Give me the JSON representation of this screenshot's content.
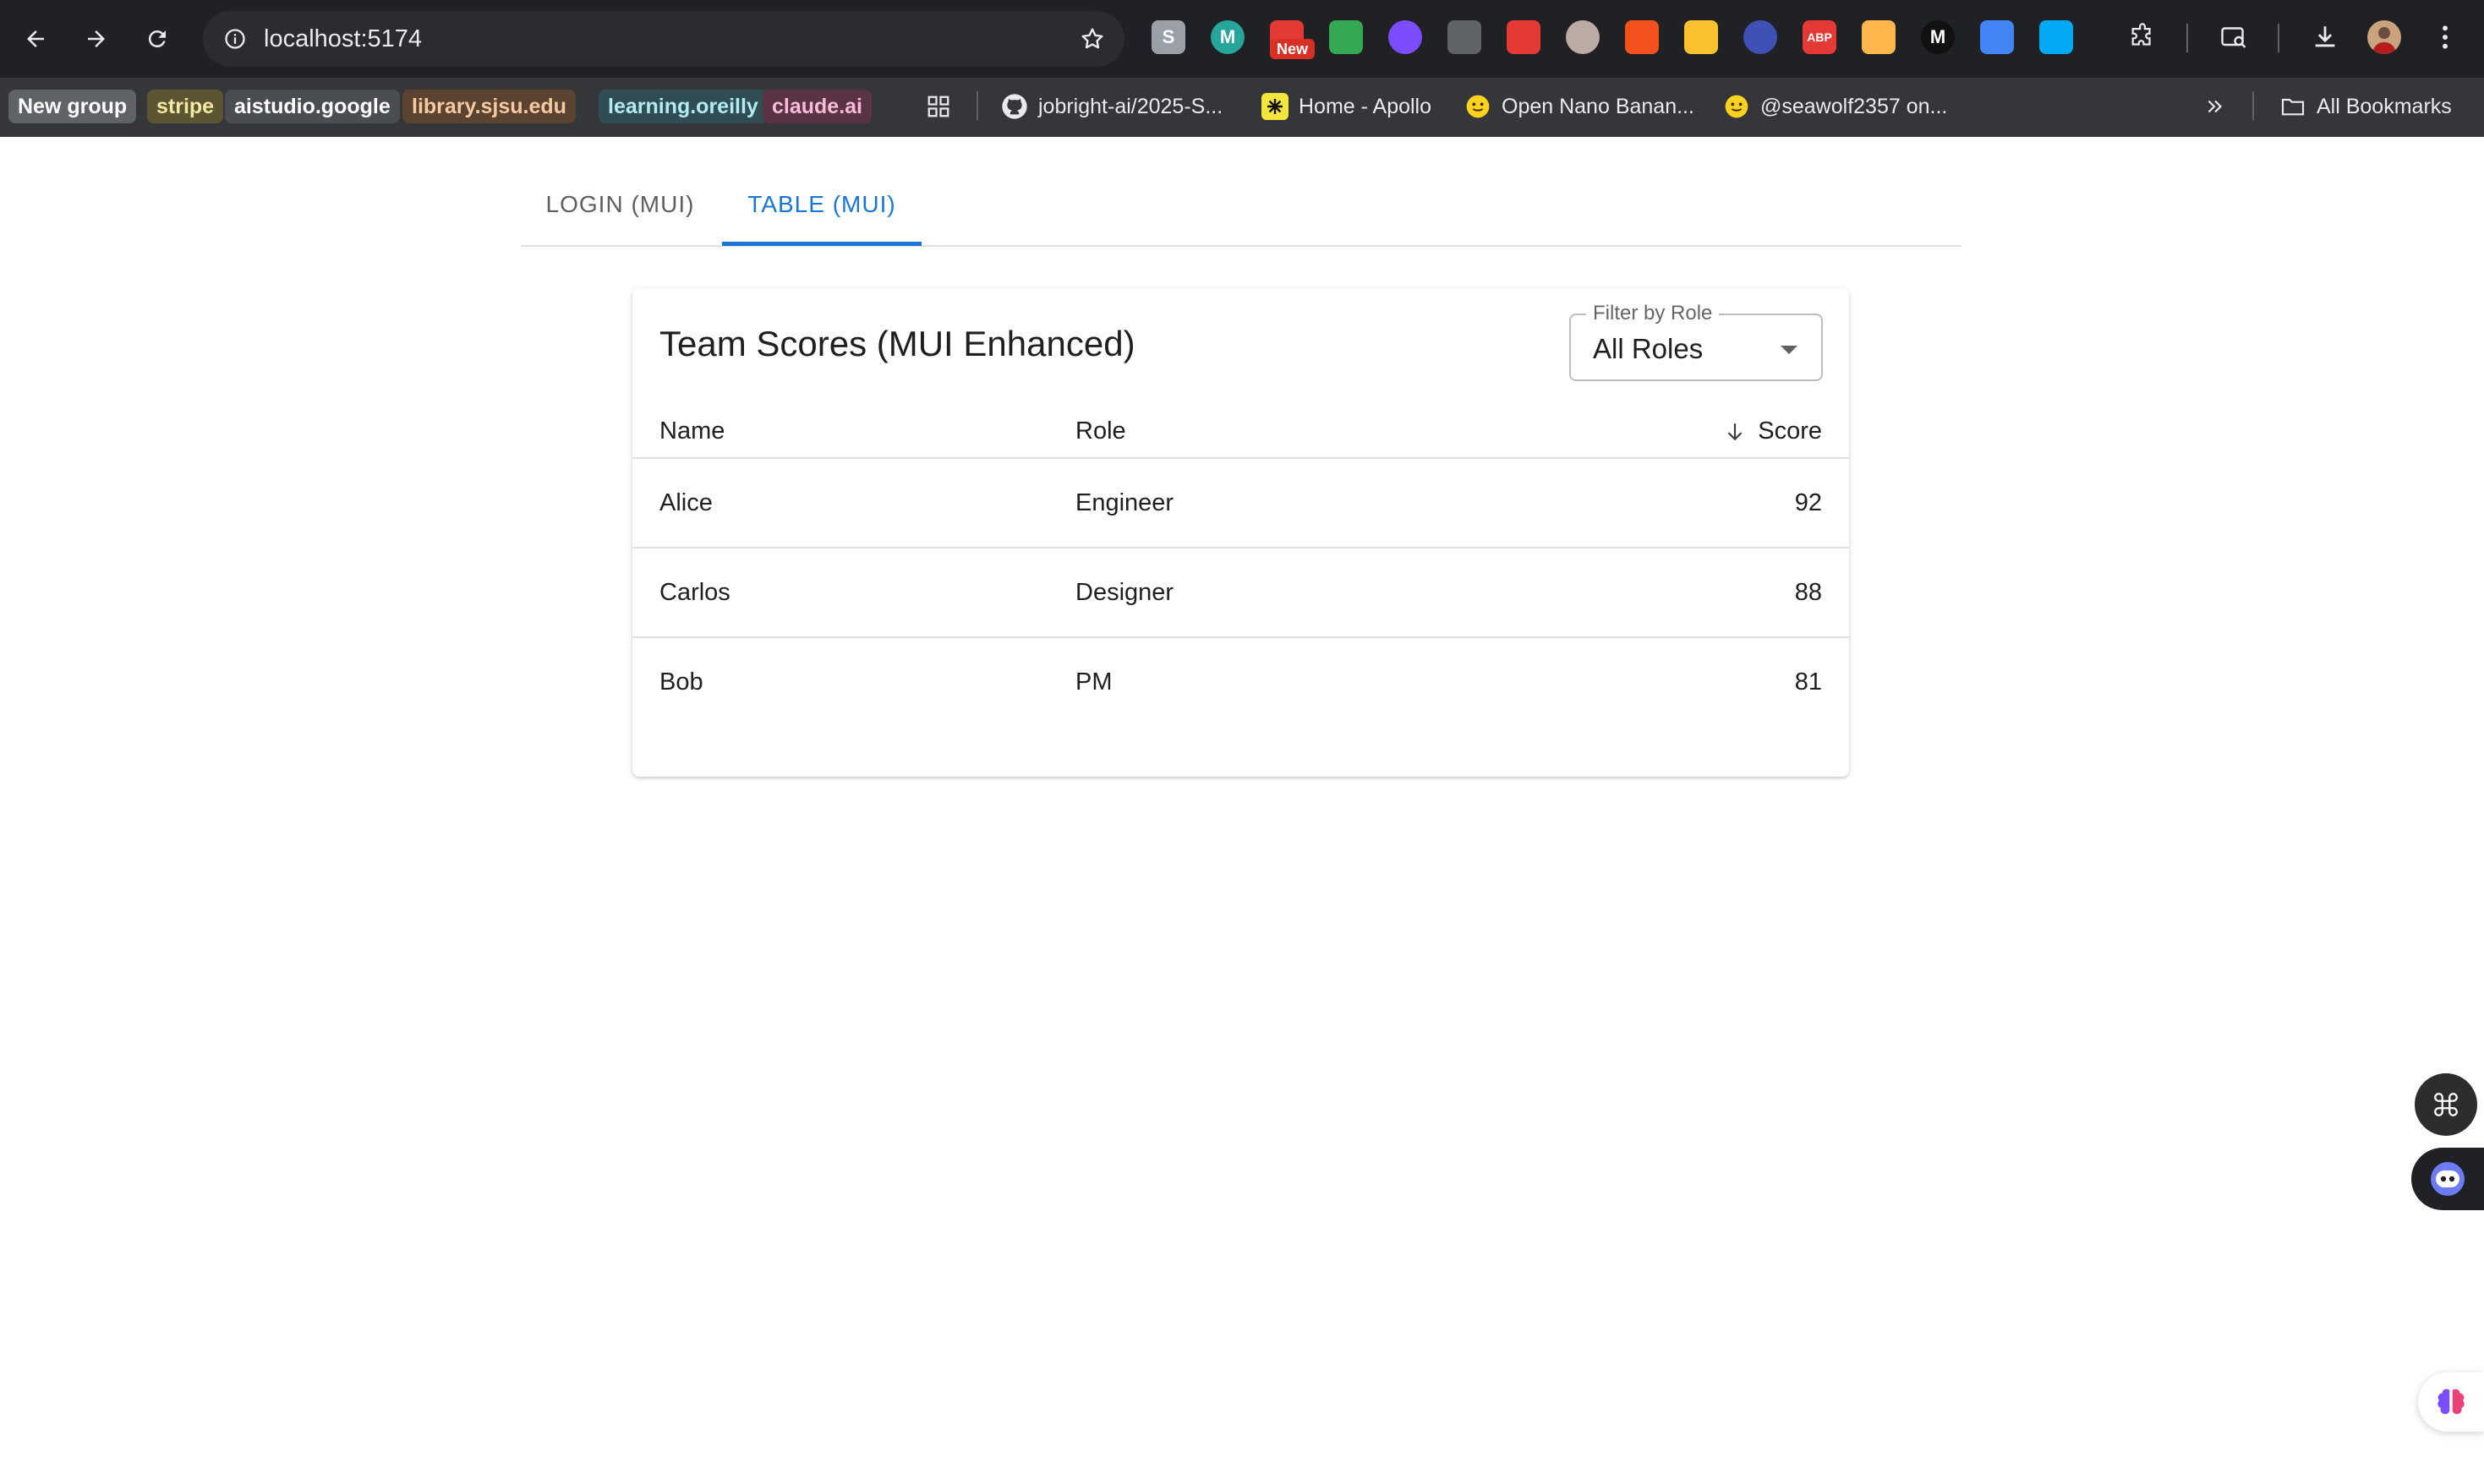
{
  "browser": {
    "url": "localhost:5174",
    "new_badge": "New",
    "extensions": [
      {
        "icon": "slack-like-extension-icon",
        "color": "#9aa0a6",
        "glyph": "S"
      },
      {
        "icon": "m-extension-icon",
        "color": "#26a69a",
        "glyph": "M"
      },
      {
        "icon": "new-extension-icon",
        "color": "#e53935",
        "glyph": ""
      },
      {
        "icon": "green-extension-icon",
        "color": "#34a853",
        "glyph": ""
      },
      {
        "icon": "brain-extension-icon",
        "color": "#7c4dff",
        "glyph": ""
      },
      {
        "icon": "reader-extension-icon",
        "color": "#5f6368",
        "glyph": ""
      },
      {
        "icon": "youtube-extension-icon",
        "color": "#e53935",
        "glyph": ""
      },
      {
        "icon": "owl-extension-icon",
        "color": "#bcaaa4",
        "glyph": ""
      },
      {
        "icon": "translate-extension-icon",
        "color": "#f4511e",
        "glyph": ""
      },
      {
        "icon": "sun-extension-icon",
        "color": "#fbc02d",
        "glyph": ""
      },
      {
        "icon": "lens-extension-icon",
        "color": "#3f51b5",
        "glyph": ""
      },
      {
        "icon": "adblock-extension-icon",
        "color": "#e53935",
        "glyph": "ABP"
      },
      {
        "icon": "coin-extension-icon",
        "color": "#ffb74d",
        "glyph": ""
      },
      {
        "icon": "medium-extension-icon",
        "color": "#111111",
        "glyph": "M"
      },
      {
        "icon": "triangle-extension-icon",
        "color": "#4285f4",
        "glyph": ""
      },
      {
        "icon": "square-extension-icon",
        "color": "#03a9f4",
        "glyph": ""
      }
    ]
  },
  "bookmarks": {
    "chips": [
      {
        "label": "New group",
        "bg": "#5f6368",
        "fg": "#ffffff"
      },
      {
        "label": "stripe",
        "bg": "#5b5531",
        "fg": "#f3e7a6"
      },
      {
        "label": "aistudio.google",
        "bg": "#4a4d52",
        "fg": "#ffffff"
      },
      {
        "label": "library.sjsu.edu",
        "bg": "#5a4330",
        "fg": "#f7c9a0"
      },
      {
        "label": "learning.oreilly",
        "bg": "#2f4d52",
        "fg": "#b2ebf2"
      },
      {
        "label": "claude.ai",
        "bg": "#5a3345",
        "fg": "#f8bbd9"
      }
    ],
    "items": [
      {
        "label": "jobright-ai/2025-S...",
        "icon": "github-icon"
      },
      {
        "label": "Home - Apollo",
        "icon": "apollo-icon"
      },
      {
        "label": "Open Nano Banan...",
        "icon": "hugging-face-icon"
      },
      {
        "label": "@seawolf2357 on...",
        "icon": "hugging-face-icon"
      }
    ],
    "all_bookmarks": "All Bookmarks"
  },
  "tabs": [
    {
      "label": "LOGIN (MUI)",
      "selected": false
    },
    {
      "label": "TABLE (MUI)",
      "selected": true
    }
  ],
  "card": {
    "title": "Team Scores (MUI Enhanced)",
    "filter": {
      "label": "Filter by Role",
      "value": "All Roles"
    },
    "columns": {
      "name": "Name",
      "role": "Role",
      "score": "Score",
      "sort": "descending"
    },
    "rows": [
      {
        "name": "Alice",
        "role": "Engineer",
        "score": "92"
      },
      {
        "name": "Carlos",
        "role": "Designer",
        "score": "88"
      },
      {
        "name": "Bob",
        "role": "PM",
        "score": "81"
      }
    ]
  },
  "colors": {
    "accent": "#1976d2",
    "chrome_dark": "#202124",
    "bookmark_bar": "#35363a"
  }
}
